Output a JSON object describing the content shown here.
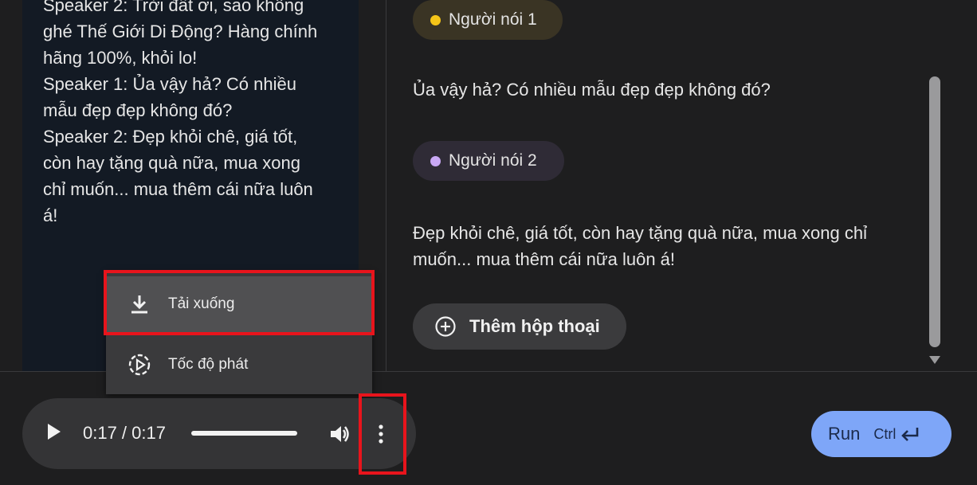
{
  "transcript": {
    "lines": [
      "Speaker 2: Trời đất ơi, sao không",
      "ghé Thế Giới Di Động? Hàng chính",
      "hãng 100%, khỏi lo!",
      "Speaker 1: Ủa vậy hả? Có nhiều",
      "mẫu đẹp đẹp không đó?",
      "Speaker 2: Đẹp khỏi chê, giá tốt,",
      "còn hay tặng quà nữa, mua xong",
      "chỉ muốn... mua thêm cái nữa luôn",
      "á!"
    ]
  },
  "dialog": {
    "speakers": [
      {
        "label": "Người nói 1",
        "color": "#f5c518",
        "text": "Ủa vậy hả? Có nhiều mẫu đẹp đẹp không đó?"
      },
      {
        "label": "Người nói 2",
        "color": "#c9a8f5",
        "text": "Đẹp khỏi chê, giá tốt, còn hay tặng quà nữa, mua xong chỉ muốn... mua thêm cái nữa luôn á!"
      }
    ],
    "add_button_label": "Thêm hộp thoại"
  },
  "menu": {
    "items": [
      {
        "label": "Tải xuống",
        "icon": "download-icon"
      },
      {
        "label": "Tốc độ phát",
        "icon": "playback-speed-icon"
      }
    ]
  },
  "audio": {
    "time": "0:17 / 0:17",
    "progress": 1.0
  },
  "run": {
    "label": "Run",
    "shortcut": "Ctrl"
  },
  "colors": {
    "accent_run": "#7ea6f8",
    "highlight": "#e8141c"
  }
}
